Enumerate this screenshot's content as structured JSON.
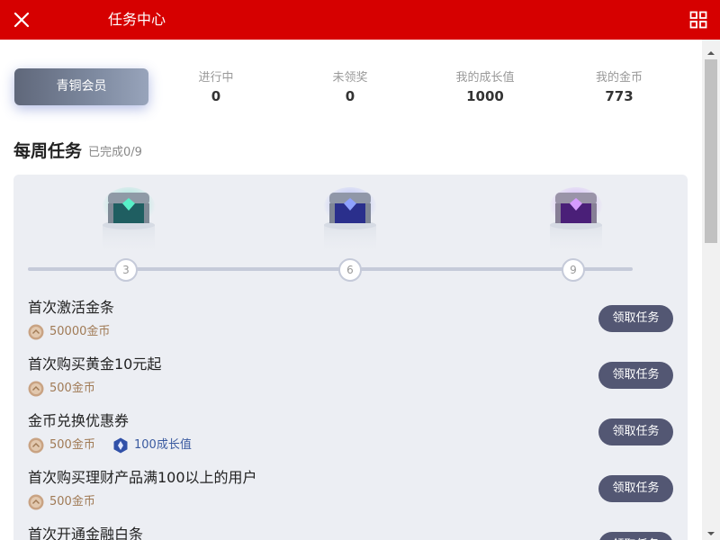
{
  "header": {
    "title": "任务中心",
    "close_icon": "close-icon",
    "menu_icon": "grid-icon",
    "bg_color": "#d60000"
  },
  "member": {
    "level": "青铜会员"
  },
  "stats": [
    {
      "label": "进行中",
      "value": "0"
    },
    {
      "label": "未领奖",
      "value": "0"
    },
    {
      "label": "我的成长值",
      "value": "1000"
    },
    {
      "label": "我的金币",
      "value": "773"
    }
  ],
  "weekly": {
    "title": "每周任务",
    "progress_text": "已完成0/9",
    "milestones": [
      {
        "value": "3",
        "chest": "teal-chest-icon"
      },
      {
        "value": "6",
        "chest": "blue-chest-icon"
      },
      {
        "value": "9",
        "chest": "purple-chest-icon"
      }
    ]
  },
  "tasks": [
    {
      "title": "首次激活金条",
      "rewards": [
        {
          "type": "coin",
          "text": "50000金币"
        }
      ],
      "button": "领取任务"
    },
    {
      "title": "首次购买黄金10元起",
      "rewards": [
        {
          "type": "coin",
          "text": "500金币"
        }
      ],
      "button": "领取任务"
    },
    {
      "title": "金币兑换优惠券",
      "rewards": [
        {
          "type": "coin",
          "text": "500金币"
        },
        {
          "type": "growth",
          "text": "100成长值"
        }
      ],
      "button": "领取任务"
    },
    {
      "title": "首次购买理财产品满100以上的用户",
      "rewards": [
        {
          "type": "coin",
          "text": "500金币"
        }
      ],
      "button": "领取任务"
    },
    {
      "title": "首次开通金融白条",
      "rewards": [],
      "button": "领取任务"
    }
  ]
}
